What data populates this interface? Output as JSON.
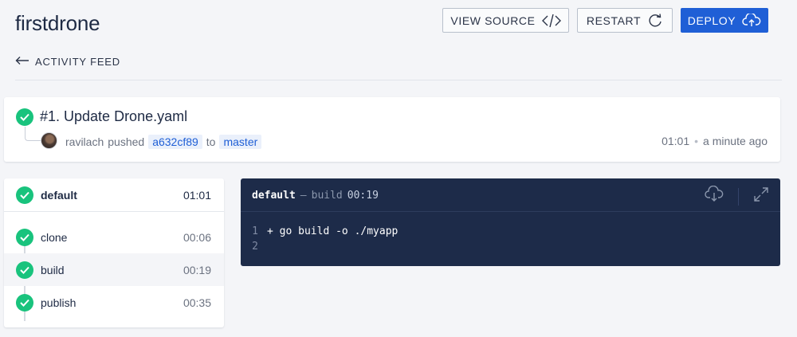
{
  "header": {
    "title": "firstdrone",
    "view_source_label": "VIEW SOURCE",
    "restart_label": "RESTART",
    "deploy_label": "DEPLOY"
  },
  "nav": {
    "back_label": "ACTIVITY FEED"
  },
  "build": {
    "title": "#1. Update Drone.yaml",
    "author": "ravilach",
    "action": "pushed",
    "commit": "a632cf89",
    "to_word": "to",
    "branch": "master",
    "duration": "01:01",
    "separator": "•",
    "relative_time": "a minute ago",
    "status": "success"
  },
  "stage": {
    "name": "default",
    "duration": "01:01",
    "steps": [
      {
        "name": "clone",
        "duration": "00:06"
      },
      {
        "name": "build",
        "duration": "00:19"
      },
      {
        "name": "publish",
        "duration": "00:35"
      }
    ]
  },
  "log": {
    "stage": "default",
    "dash": "—",
    "step": "build",
    "duration": "00:19",
    "lines": [
      {
        "num": "1",
        "text": "+ go build -o ./myapp"
      },
      {
        "num": "2",
        "text": ""
      }
    ]
  },
  "colors": {
    "success": "#19c37d",
    "primary": "#1f5fd6",
    "log_bg": "#1d2b49"
  },
  "icons": {
    "view_source": "code-icon",
    "restart": "restart-icon",
    "deploy": "cloud-upload-icon",
    "back": "arrow-left-icon",
    "download": "cloud-download-icon",
    "expand": "expand-icon",
    "status": "check-circle-icon"
  }
}
